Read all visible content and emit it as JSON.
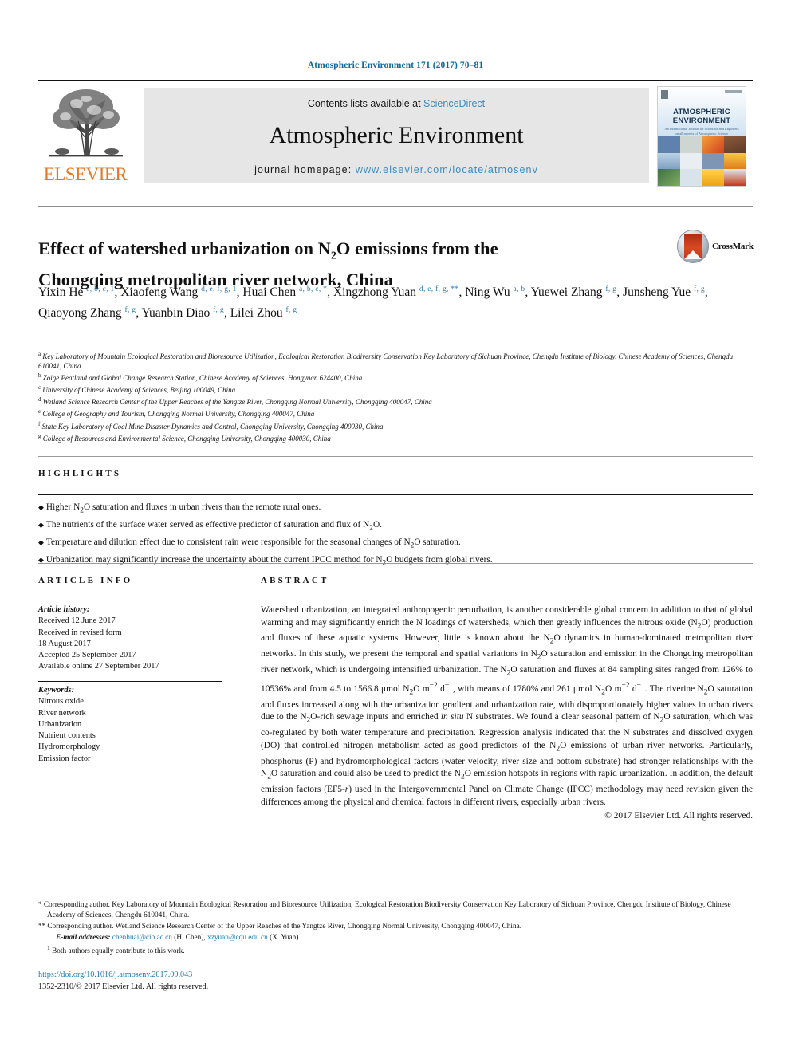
{
  "running_head": "Atmospheric Environment 171 (2017) 70–81",
  "masthead": {
    "contents_prefix": "Contents lists available at ",
    "sciencedirect": "ScienceDirect",
    "journal_name": "Atmospheric Environment",
    "homepage_prefix": "journal homepage: ",
    "homepage_url": "www.elsevier.com/locate/atmosenv",
    "publisher_logo_text": "ELSEVIER",
    "cover_title": "ATMOSPHERIC ENVIRONMENT",
    "cover_subtitle": "An International Journal for Scientists and Engineers on all aspects of Atmospheric Science",
    "accent_blue": "#3a8cc1",
    "elsevier_orange": "#e87722"
  },
  "crossmark": {
    "label": "CrossMark"
  },
  "article": {
    "title_line1": "Effect of watershed urbanization on N",
    "title_sub1": "2",
    "title_line1b": "O emissions from the",
    "title_line2": "Chongqing metropolitan river network, China",
    "authors": [
      {
        "name": "Yixin He",
        "affs": "a, b, c, 1",
        "sep": ", "
      },
      {
        "name": "Xiaofeng Wang",
        "affs": "d, e, f, g, 1",
        "sep": ", "
      },
      {
        "name": "Huai Chen",
        "affs": "a, b, c, *",
        "sep": ", "
      },
      {
        "name": "Xingzhong Yuan",
        "affs": "d, e, f, g, **",
        "sep": ", "
      },
      {
        "name": "Ning Wu",
        "affs": "a, b",
        "sep": ", "
      },
      {
        "name": "Yuewei Zhang",
        "affs": "f, g",
        "sep": ", "
      },
      {
        "name": "Junsheng Yue",
        "affs": "f, g",
        "sep": ", "
      },
      {
        "name": "Qiaoyong Zhang",
        "affs": "f, g",
        "sep": ", "
      },
      {
        "name": "Yuanbin Diao",
        "affs": "f, g",
        "sep": ", "
      },
      {
        "name": "Lilei Zhou",
        "affs": "f, g",
        "sep": ""
      }
    ],
    "affiliations": [
      {
        "mark": "a",
        "text": "Key Laboratory of Mountain Ecological Restoration and Bioresource Utilization, Ecological Restoration Biodiversity Conservation Key Laboratory of Sichuan Province, Chengdu Institute of Biology, Chinese Academy of Sciences, Chengdu 610041, China"
      },
      {
        "mark": "b",
        "text": "Zoige Peatland and Global Change Research Station, Chinese Academy of Sciences, Hongyuan 624400, China"
      },
      {
        "mark": "c",
        "text": "University of Chinese Academy of Sciences, Beijing 100049, China"
      },
      {
        "mark": "d",
        "text": "Wetland Science Research Center of the Upper Reaches of the Yangtze River, Chongqing Normal University, Chongqing 400047, China"
      },
      {
        "mark": "e",
        "text": "College of Geography and Tourism, Chongqing Normal University, Chongqing 400047, China"
      },
      {
        "mark": "f",
        "text": "State Key Laboratory of Coal Mine Disaster Dynamics and Control, Chongqing University, Chongqing 400030, China"
      },
      {
        "mark": "g",
        "text": "College of Resources and Environmental Science, Chongqing University, Chongqing 400030, China"
      }
    ]
  },
  "highlights": {
    "heading": "HIGHLIGHTS",
    "items": [
      "Higher N2O saturation and fluxes in urban rivers than the remote rural ones.",
      "The nutrients of the surface water served as effective predictor of saturation and flux of N2O.",
      "Temperature and dilution effect due to consistent rain were responsible for the seasonal changes of N2O saturation.",
      "Urbanization may significantly increase the uncertainty about the current IPCC method for N2O budgets from global rivers."
    ]
  },
  "article_info": {
    "heading": "ARTICLE INFO",
    "history_label": "Article history:",
    "history": [
      "Received 12 June 2017",
      "Received in revised form",
      "18 August 2017",
      "Accepted 25 September 2017",
      "Available online 27 September 2017"
    ],
    "keywords_label": "Keywords:",
    "keywords": [
      "Nitrous oxide",
      "River network",
      "Urbanization",
      "Nutrient contents",
      "Hydromorphology",
      "Emission factor"
    ]
  },
  "abstract": {
    "heading": "ABSTRACT",
    "copyright": "© 2017 Elsevier Ltd. All rights reserved."
  },
  "footnotes": {
    "corresponding1_sym": "*",
    "corresponding1": "Corresponding author. Key Laboratory of Mountain Ecological Restoration and Bioresource Utilization, Ecological Restoration Biodiversity Conservation Key Laboratory of Sichuan Province, Chengdu Institute of Biology, Chinese Academy of Sciences, Chengdu 610041, China.",
    "corresponding2_sym": "**",
    "corresponding2": "Corresponding author. Wetland Science Research Center of the Upper Reaches of the Yangtze River, Chongqing Normal University, Chongqing 400047, China.",
    "email_label": "E-mail addresses:",
    "email1": "chenhuai@cib.ac.cn",
    "email1_name": "(H. Chen),",
    "email2": "xzyuan@cqu.edu.cn",
    "email2_name": "(X. Yuan).",
    "equal_sym": "1",
    "equal_contribution": "Both authors equally contribute to this work."
  },
  "footer": {
    "doi": "https://doi.org/10.1016/j.atmosenv.2017.09.043",
    "issn_line": "1352-2310/© 2017 Elsevier Ltd. All rights reserved."
  }
}
